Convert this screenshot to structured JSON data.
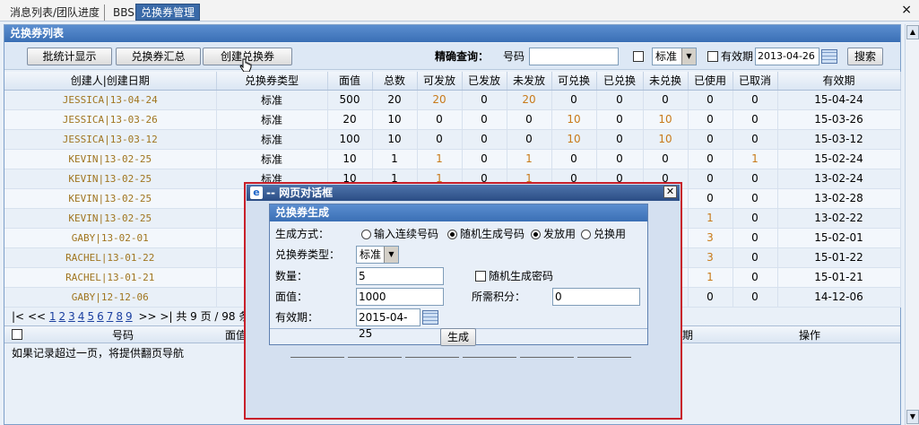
{
  "tabs": [
    "消息列表/团队进度",
    "BBS",
    "兑换券管理"
  ],
  "close_glyph": "×",
  "panel": {
    "title": "兑换券列表"
  },
  "toolbar": {
    "btn_stats": "批统计显示",
    "btn_summary": "兑换券汇总",
    "btn_create": "创建兑换券",
    "search_label": "精确查询：",
    "number_label": "号码",
    "number_value": "",
    "type_value": "标准",
    "expiry_label": "有效期",
    "expiry_value": "2013-04-26",
    "search_btn": "搜索"
  },
  "table": {
    "headers": [
      "创建人|创建日期",
      "兑换券类型",
      "面值",
      "总数",
      "可发放",
      "已发放",
      "未发放",
      "可兑换",
      "已兑换",
      "未兑换",
      "已使用",
      "已取消",
      "有效期"
    ],
    "rows": [
      [
        "JESSICA|13-04-24",
        "标准",
        "500",
        "20",
        "20",
        "0",
        "20",
        "0",
        "0",
        "0",
        "0",
        "0",
        "15-04-24"
      ],
      [
        "JESSICA|13-03-26",
        "标准",
        "20",
        "10",
        "0",
        "0",
        "0",
        "10",
        "0",
        "10",
        "0",
        "0",
        "15-03-26"
      ],
      [
        "JESSICA|13-03-12",
        "标准",
        "100",
        "10",
        "0",
        "0",
        "0",
        "10",
        "0",
        "10",
        "0",
        "0",
        "15-03-12"
      ],
      [
        "KEVIN|13-02-25",
        "标准",
        "10",
        "1",
        "1",
        "0",
        "1",
        "0",
        "0",
        "0",
        "0",
        "1",
        "15-02-24"
      ],
      [
        "KEVIN|13-02-25",
        "标准",
        "10",
        "1",
        "1",
        "0",
        "1",
        "0",
        "0",
        "0",
        "0",
        "0",
        "13-02-24"
      ],
      [
        "KEVIN|13-02-25",
        "",
        "",
        "",
        "",
        "",
        "",
        "",
        "",
        "",
        "0",
        "0",
        "13-02-28"
      ],
      [
        "KEVIN|13-02-25",
        "",
        "",
        "",
        "",
        "",
        "",
        "",
        "",
        "",
        "1",
        "0",
        "13-02-22"
      ],
      [
        "GABY|13-02-01",
        "",
        "",
        "",
        "",
        "",
        "",
        "",
        "",
        "",
        "3",
        "0",
        "15-02-01"
      ],
      [
        "RACHEL|13-01-22",
        "",
        "",
        "",
        "",
        "",
        "",
        "",
        "",
        "",
        "3",
        "0",
        "15-01-22"
      ],
      [
        "RACHEL|13-01-21",
        "",
        "",
        "",
        "",
        "",
        "",
        "",
        "",
        "",
        "1",
        "0",
        "15-01-21"
      ],
      [
        "GABY|12-12-06",
        "",
        "",
        "",
        "",
        "",
        "",
        "",
        "",
        "",
        "0",
        "0",
        "14-12-06"
      ]
    ]
  },
  "pager": {
    "first": "|<",
    "prev": "<<",
    "pages": [
      "1",
      "2",
      "3",
      "4",
      "5",
      "6",
      "7",
      "8",
      "9"
    ],
    "next": ">>",
    "last": ">|",
    "summary": "共 9 页 / 98 条"
  },
  "bottom": {
    "col_number": "号码",
    "col_value": "面值",
    "col_expiry": "期",
    "col_action": "操作",
    "note": "如果记录超过一页，将提供翻页导航"
  },
  "dialog": {
    "title": "-- 网页对话框",
    "form_title": "兑换券生成",
    "gen_method_label": "生成方式：",
    "opt_sequential": "输入连续号码",
    "opt_random": "随机生成号码",
    "opt_issue": "发放用",
    "opt_redeem": "兑换用",
    "type_label": "兑换券类型：",
    "type_value": "标准",
    "qty_label": "数量：",
    "qty_value": "5",
    "random_pwd_label": "随机生成密码",
    "value_label": "面值：",
    "value_value": "1000",
    "points_label": "所需积分：",
    "points_value": "0",
    "expiry_label": "有效期：",
    "expiry_value": "2015-04-25",
    "generate_btn": "生成"
  },
  "colors": {
    "accent": "#3a6fb5",
    "highlight_number": "#c87a1a",
    "dialog_border": "#c8202a"
  },
  "icons": [
    "close-icon",
    "calendar-icon",
    "ie-icon",
    "cursor-hand-icon",
    "dropdown-arrow-icon"
  ]
}
